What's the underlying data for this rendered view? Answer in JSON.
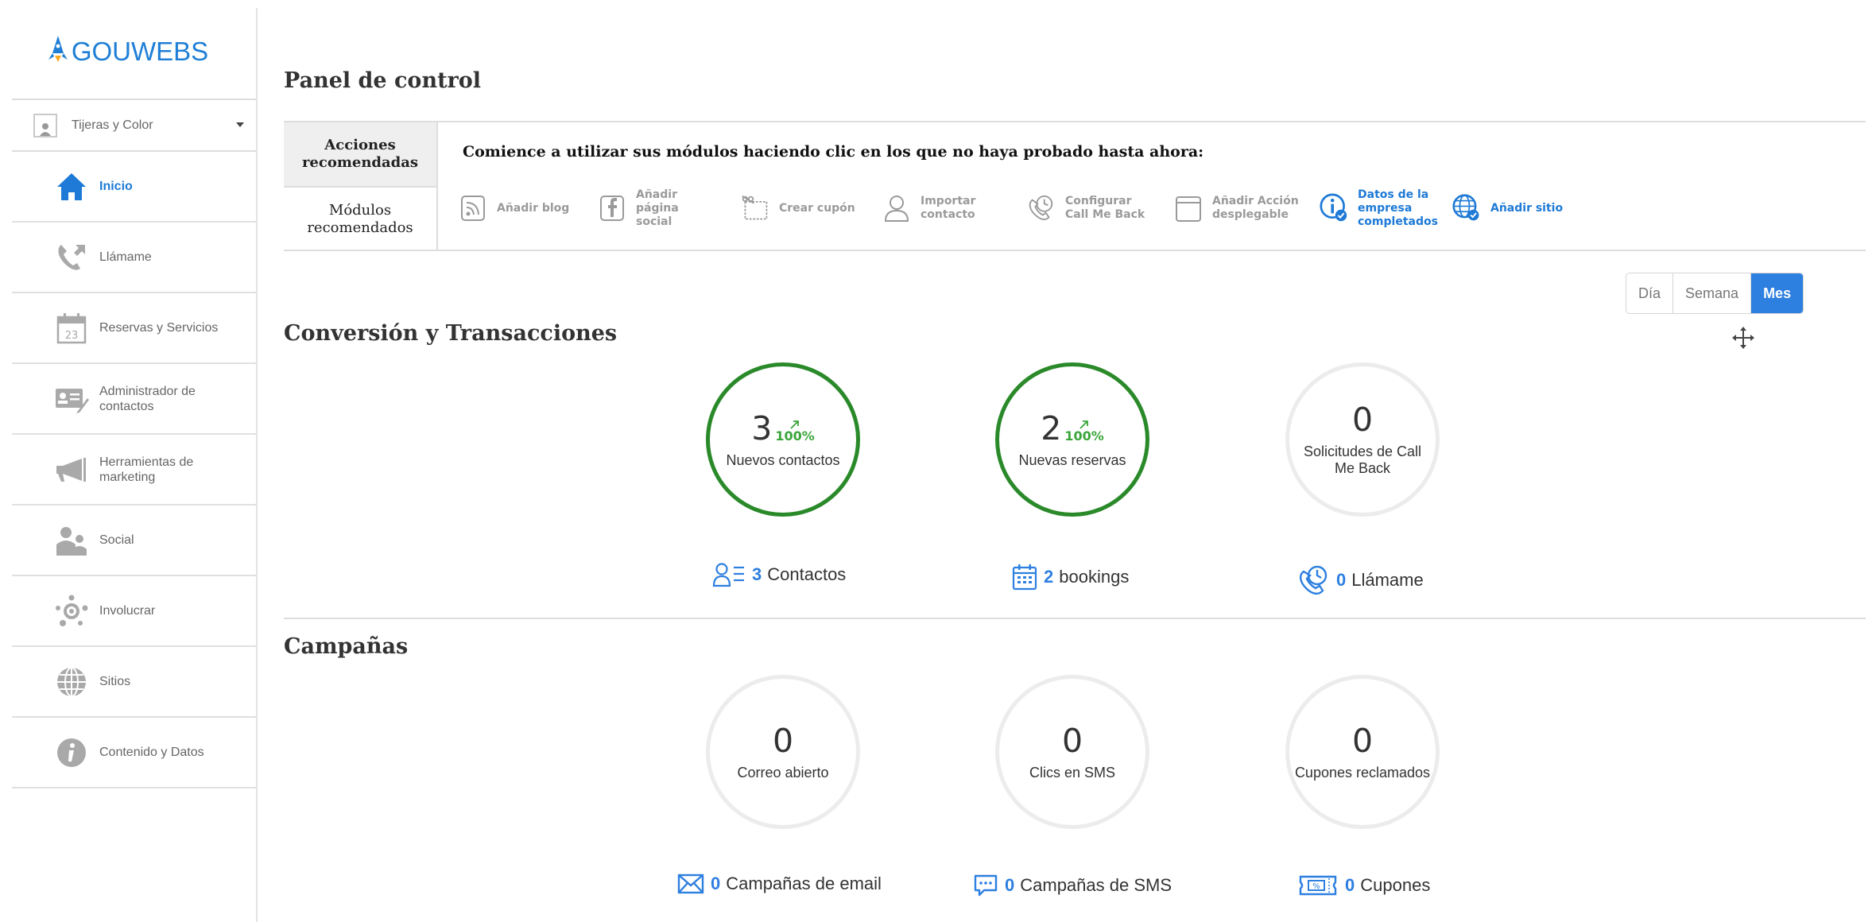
{
  "brand": {
    "logo_text": "GOUWEBS",
    "accent": "#1e7ad6"
  },
  "account": {
    "name": "Tijeras y Color"
  },
  "sidebar": {
    "items": [
      {
        "label": "Inicio",
        "icon": "home-icon",
        "active": true
      },
      {
        "label": "Llámame",
        "icon": "phone-icon"
      },
      {
        "label": "Reservas y Servicios",
        "icon": "calendar-icon"
      },
      {
        "label": "Administrador de contactos",
        "icon": "contact-card-icon"
      },
      {
        "label": "Herramientas de marketing",
        "icon": "megaphone-icon"
      },
      {
        "label": "Social",
        "icon": "people-icon"
      },
      {
        "label": "Involucrar",
        "icon": "network-icon"
      },
      {
        "label": "Sitios",
        "icon": "globe-icon"
      },
      {
        "label": "Contenido y Datos",
        "icon": "info-icon"
      }
    ]
  },
  "main": {
    "title": "Panel de control",
    "recommend": {
      "tabs": [
        "Acciones recomendadas",
        "Módulos recomendados"
      ],
      "heading": "Comience a utilizar sus módulos haciendo clic en los que no haya probado hasta ahora:",
      "modules": [
        {
          "label": "Añadir blog",
          "icon": "blog-icon",
          "done": false
        },
        {
          "label": "Añadir página social",
          "icon": "facebook-icon",
          "done": false
        },
        {
          "label": "Crear cupón",
          "icon": "coupon-icon",
          "done": false
        },
        {
          "label": "Importar contacto",
          "icon": "user-outline-icon",
          "done": false
        },
        {
          "label": "Configurar Call Me Back",
          "icon": "callback-icon",
          "done": false
        },
        {
          "label": "Añadir Acción desplegable",
          "icon": "window-icon",
          "done": false
        },
        {
          "label": "Datos de la empresa completados",
          "icon": "info-check-icon",
          "done": true
        },
        {
          "label": "Añadir sitio",
          "icon": "globe-check-icon",
          "done": true
        }
      ]
    },
    "period": {
      "options": [
        "Día",
        "Semana",
        "Mes"
      ],
      "selected": "Mes"
    },
    "conversion": {
      "title": "Conversión y Transacciones",
      "kpis": [
        {
          "value": "3",
          "trend": "100%",
          "label": "Nuevos contactos",
          "highlight": true
        },
        {
          "value": "2",
          "trend": "100%",
          "label": "Nuevas reservas",
          "highlight": true
        },
        {
          "value": "0",
          "trend": "",
          "label": "Solicitudes de Call Me Back",
          "highlight": false
        }
      ],
      "stats": [
        {
          "count": "3",
          "label": "Contactos",
          "icon": "contacts-list-icon"
        },
        {
          "count": "2",
          "label": "bookings",
          "icon": "calendar-grid-icon"
        },
        {
          "count": "0",
          "label": "Llámame",
          "icon": "phone-clock-icon"
        }
      ]
    },
    "campaigns": {
      "title": "Campañas",
      "kpis": [
        {
          "value": "0",
          "label": "Correo abierto"
        },
        {
          "value": "0",
          "label": "Clics en SMS"
        },
        {
          "value": "0",
          "label": "Cupones reclamados"
        }
      ],
      "stats": [
        {
          "count": "0",
          "label": "Campañas de email",
          "icon": "envelope-icon"
        },
        {
          "count": "0",
          "label": "Campañas de SMS",
          "icon": "chat-icon"
        },
        {
          "count": "0",
          "label": "Cupones",
          "icon": "ticket-icon"
        }
      ]
    }
  },
  "colors": {
    "green_ring": "#2a8a2a",
    "trend_green": "#3aa53a",
    "blue": "#2d7fe0",
    "ring_gray": "#ececec"
  }
}
